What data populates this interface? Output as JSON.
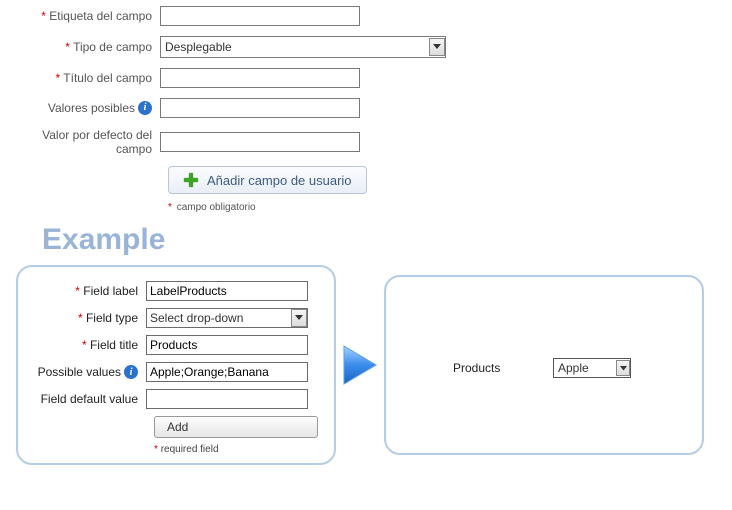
{
  "form": {
    "labels": {
      "etiqueta": "Etiqueta del campo",
      "tipo": "Tipo de campo",
      "titulo": "Título del campo",
      "valores": "Valores posibles",
      "default": "Valor por defecto del campo"
    },
    "values": {
      "etiqueta": "",
      "tipo": "Desplegable",
      "titulo": "",
      "valores": "",
      "default": ""
    },
    "add_button": "Añadir campo de usuario",
    "required_note": "campo obligatorio"
  },
  "example_title": "Example",
  "example_left": {
    "labels": {
      "field_label": "Field label",
      "field_type": "Field type",
      "field_title": "Field title",
      "possible_values": "Possible values",
      "default": "Field default value"
    },
    "values": {
      "field_label": "LabelProducts",
      "field_type": "Select drop-down",
      "field_title": "Products",
      "possible_values": "Apple;Orange;Banana",
      "default": ""
    },
    "add_button": "Add",
    "required_note": "required field"
  },
  "example_right": {
    "label": "Products",
    "value": "Apple"
  },
  "asterisk": "*"
}
